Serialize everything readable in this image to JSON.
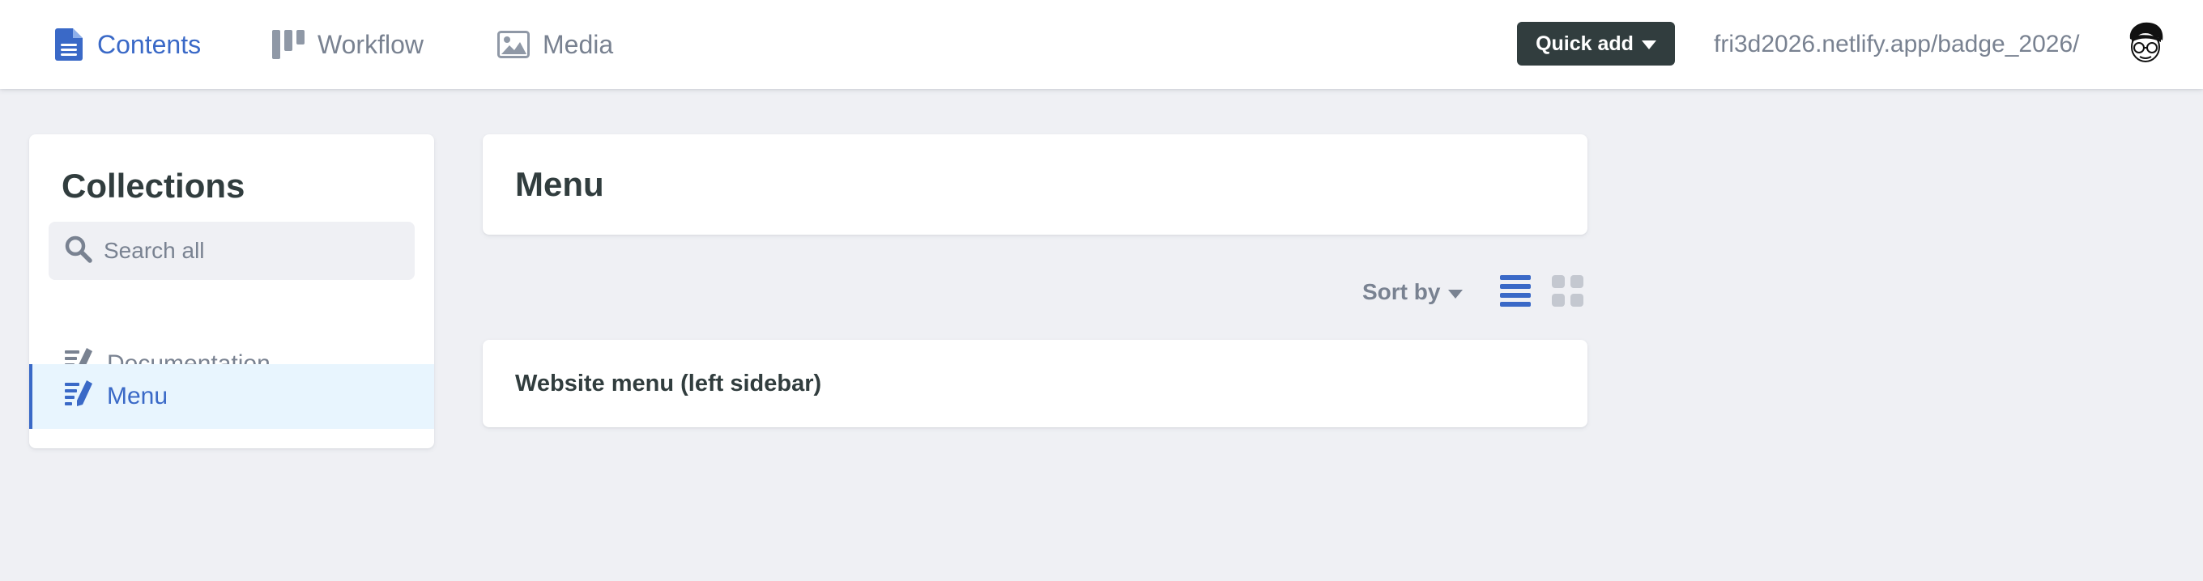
{
  "topbar": {
    "nav": [
      {
        "label": "Contents",
        "icon": "document-icon",
        "active": true
      },
      {
        "label": "Workflow",
        "icon": "kanban-icon",
        "active": false
      },
      {
        "label": "Media",
        "icon": "image-icon",
        "active": false
      }
    ],
    "quick_add_label": "Quick add",
    "site_url": "fri3d2026.netlify.app/badge_2026/"
  },
  "sidebar": {
    "title": "Collections",
    "search_placeholder": "Search all",
    "items": [
      {
        "label": "Documentation",
        "icon": "edit-list-icon",
        "active": false
      },
      {
        "label": "Menu",
        "icon": "edit-list-icon",
        "active": true
      }
    ]
  },
  "main": {
    "title": "Menu",
    "sort_label": "Sort by",
    "view_modes": [
      "list",
      "grid"
    ],
    "active_view": "list",
    "entries": [
      {
        "title": "Website menu (left sidebar)"
      }
    ]
  },
  "colors": {
    "accent": "#3a69c7",
    "muted": "#798291",
    "text": "#313d3e",
    "background": "#eff0f4",
    "active_bg": "#e8f5fe"
  }
}
